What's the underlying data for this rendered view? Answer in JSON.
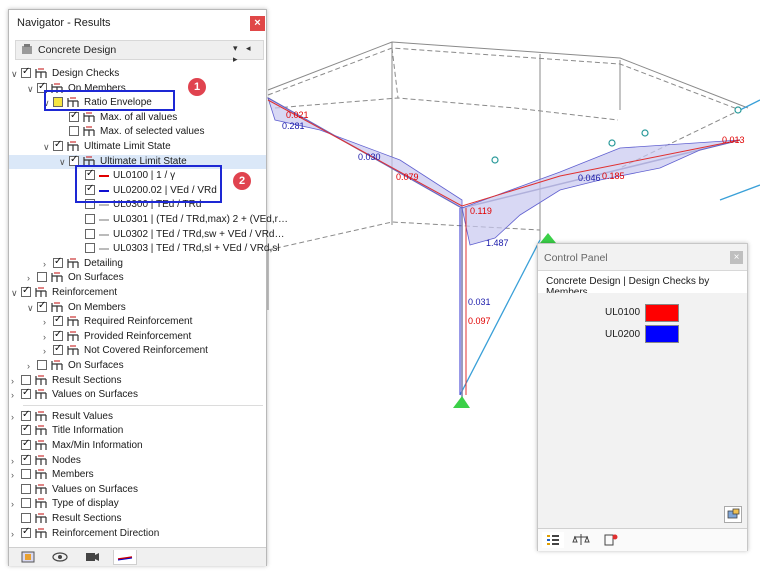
{
  "navigator": {
    "title": "Navigator - Results",
    "close_label": "×",
    "combo_label": "Concrete Design",
    "combo_arrows": "▾ ◂ ▸"
  },
  "tree": [
    {
      "label": "Design Checks",
      "checked": true
    },
    {
      "label": "On Members",
      "checked": true
    },
    {
      "label": "Ratio Envelope",
      "checked": false
    },
    {
      "label": "Max. of all values",
      "checked": true
    },
    {
      "label": "Max. of selected values",
      "checked": false
    },
    {
      "label": "Ultimate Limit State",
      "checked": true
    },
    {
      "label": "Ultimate Limit State",
      "checked": true
    },
    {
      "label": "UL0100 | 1 / γ",
      "checked": true
    },
    {
      "label": "UL0200.02 | VEd / VRd",
      "checked": true
    },
    {
      "label": "UL0300 | TEd / TRd",
      "checked": false
    },
    {
      "label": "UL0301 | (TEd / TRd,max) 2 + (VEd,r…",
      "checked": false
    },
    {
      "label": "UL0302 | TEd / TRd,sw + VEd / VRd…",
      "checked": false
    },
    {
      "label": "UL0303 | TEd / TRd,sl + VEd / VRd,sl",
      "checked": false
    },
    {
      "label": "Detailing",
      "checked": true
    },
    {
      "label": "On Surfaces",
      "checked": false
    },
    {
      "label": "Reinforcement",
      "checked": true
    },
    {
      "label": "On Members",
      "checked": true
    },
    {
      "label": "Required Reinforcement",
      "checked": true
    },
    {
      "label": "Provided Reinforcement",
      "checked": true
    },
    {
      "label": "Not Covered Reinforcement",
      "checked": true
    },
    {
      "label": "On Surfaces",
      "checked": false
    },
    {
      "label": "Result Sections",
      "checked": false
    },
    {
      "label": "Values on Surfaces",
      "checked": true
    },
    {
      "label": "Result Values",
      "checked": true
    },
    {
      "label": "Title Information",
      "checked": true
    },
    {
      "label": "Max/Min Information",
      "checked": true
    },
    {
      "label": "Nodes",
      "checked": true
    },
    {
      "label": "Members",
      "checked": false
    },
    {
      "label": "Values on Surfaces",
      "checked": false
    },
    {
      "label": "Type of display",
      "checked": false
    },
    {
      "label": "Result Sections",
      "checked": false
    },
    {
      "label": "Reinforcement Direction",
      "checked": true
    }
  ],
  "markers": {
    "one": "1",
    "two": "2"
  },
  "control_panel": {
    "title": "Control Panel",
    "close_label": "×",
    "header": "Concrete Design | Design Checks by Members",
    "legend": [
      {
        "label": "UL0100",
        "color": "#ff0000"
      },
      {
        "label": "UL0200",
        "color": "#0000ff"
      }
    ]
  },
  "model_values": [
    {
      "text": "0.021",
      "color": "#e00000"
    },
    {
      "text": "0.281",
      "color": "#1a1aaa"
    },
    {
      "text": "0.030",
      "color": "#1a1aaa"
    },
    {
      "text": "0.079",
      "color": "#e00000"
    },
    {
      "text": "0.119",
      "color": "#e00000"
    },
    {
      "text": "1.487",
      "color": "#1a1aaa"
    },
    {
      "text": "0.046",
      "color": "#1a1aaa"
    },
    {
      "text": "0.185",
      "color": "#e00000"
    },
    {
      "text": "0.013",
      "color": "#e00000"
    },
    {
      "text": "0.031",
      "color": "#1a1aaa"
    },
    {
      "text": "0.097",
      "color": "#e00000"
    }
  ]
}
